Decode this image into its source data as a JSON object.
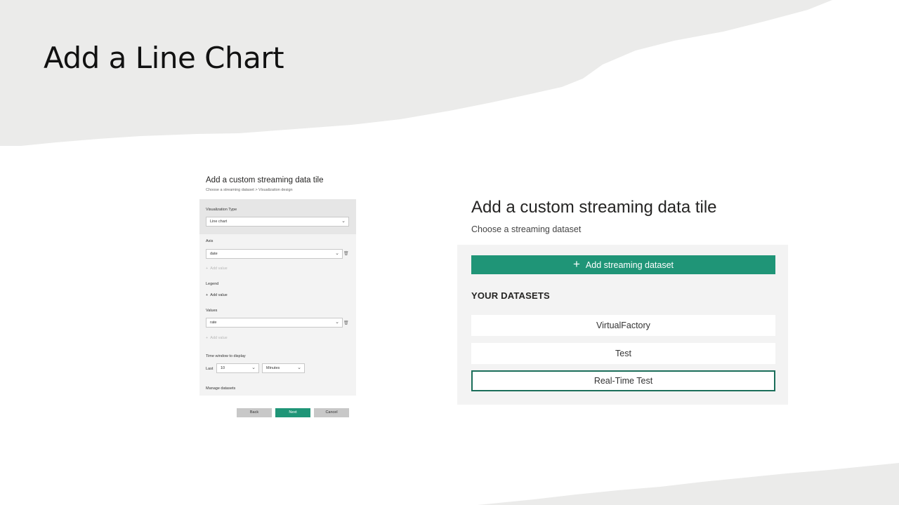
{
  "slide": {
    "title": "Add a Line Chart"
  },
  "left_panel": {
    "title": "Add a custom streaming data tile",
    "breadcrumb": "Choose a streaming dataset > Visualization design",
    "visualization_type": {
      "label": "Visualization Type",
      "value": "Line chart"
    },
    "axis": {
      "label": "Axis",
      "value": "date",
      "add_value": "Add value"
    },
    "legend": {
      "label": "Legend",
      "add_value": "Add value"
    },
    "values": {
      "label": "Values",
      "value": "rate",
      "add_value": "Add value"
    },
    "time_window": {
      "label": "Time window to display",
      "last_label": "Last",
      "amount": "10",
      "unit": "Minutes"
    },
    "manage_datasets": "Manage datasets",
    "buttons": {
      "back": "Back",
      "next": "Next",
      "cancel": "Cancel"
    }
  },
  "right_panel": {
    "title": "Add a custom streaming data tile",
    "subtitle": "Choose a streaming dataset",
    "add_button": "Add streaming dataset",
    "datasets_heading": "YOUR DATASETS",
    "datasets": [
      "VirtualFactory",
      "Test",
      "Real-Time Test"
    ],
    "selected_dataset": "Real-Time Test"
  },
  "colors": {
    "accent": "#1f9577",
    "selected_border": "#1b6e5a",
    "panel_bg": "#f3f3f3",
    "header_bg": "#ebebea"
  }
}
